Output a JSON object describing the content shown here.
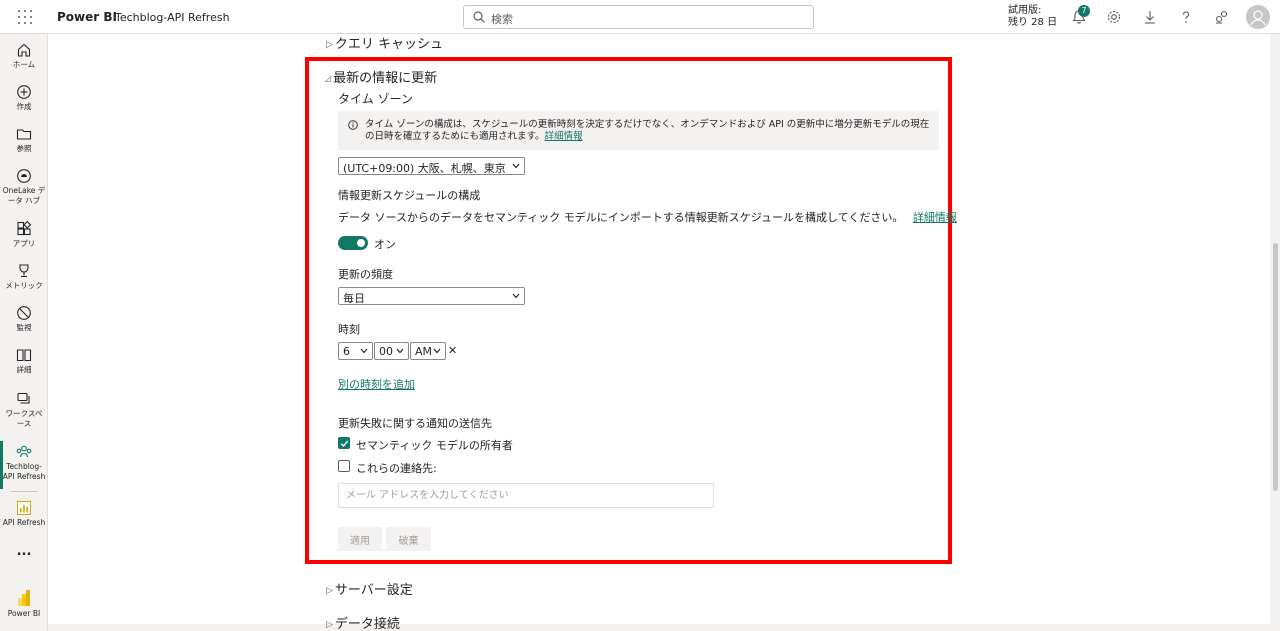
{
  "topbar": {
    "brand": "Power BI",
    "workspace": "Techblog-API Refresh",
    "search_placeholder": "検索",
    "trial_line1": "試用版:",
    "trial_line2": "残り 28 日",
    "notification_count": "7"
  },
  "rail": {
    "items": [
      {
        "label": "ホーム",
        "icon": "home-icon"
      },
      {
        "label": "作成",
        "icon": "create-icon"
      },
      {
        "label": "参照",
        "icon": "browse-icon"
      },
      {
        "label": "OneLake デ\nータ ハブ",
        "icon": "onelake-icon"
      },
      {
        "label": "アプリ",
        "icon": "apps-icon"
      },
      {
        "label": "メトリック",
        "icon": "metrics-icon"
      },
      {
        "label": "監視",
        "icon": "monitor-icon"
      },
      {
        "label": "詳細",
        "icon": "learn-icon"
      },
      {
        "label": "ワークスペ\nース",
        "icon": "workspaces-icon"
      },
      {
        "label": "Techblog-\nAPI Refresh",
        "icon": "workspace-people-icon"
      },
      {
        "label": "API Refresh",
        "icon": "report-icon"
      },
      {
        "label": "Power BI",
        "icon": "powerbi-logo-icon"
      }
    ],
    "more": "..."
  },
  "sections": {
    "query_cache": "クエリ キャッシュ",
    "server_settings": "サーバー設定",
    "data_connection": "データ接続"
  },
  "refresh": {
    "title": "最新の情報に更新",
    "timezone_label": "タイム ゾーン",
    "info_text": "タイム ゾーンの構成は、スケジュールの更新時刻を決定するだけでなく、オンデマンドおよび API の更新中に増分更新モデルの現在の日時を確立するためにも適用されます。",
    "info_link": "詳細情報",
    "timezone_value": "(UTC+09:00) 大阪、札幌、東京",
    "schedule_title": "情報更新スケジュールの構成",
    "schedule_desc": "データ ソースからのデータをセマンティック モデルにインポートする情報更新スケジュールを構成してください。",
    "schedule_link": "詳細情報",
    "toggle_label": "オン",
    "frequency_label": "更新の頻度",
    "frequency_value": "毎日",
    "time_label": "時刻",
    "hour": "6",
    "minute": "00",
    "ampm": "AM",
    "remove": "✕",
    "add_time": "別の時刻を追加",
    "notify_label": "更新失敗に関する通知の送信先",
    "owner_label": "セマンティック モデルの所有者",
    "contacts_label": "これらの連絡先:",
    "email_placeholder": "メール アドレスを入力してください",
    "apply": "適用",
    "discard": "破棄"
  },
  "colors": {
    "accent": "#117865",
    "highlight": "#ff0000"
  }
}
